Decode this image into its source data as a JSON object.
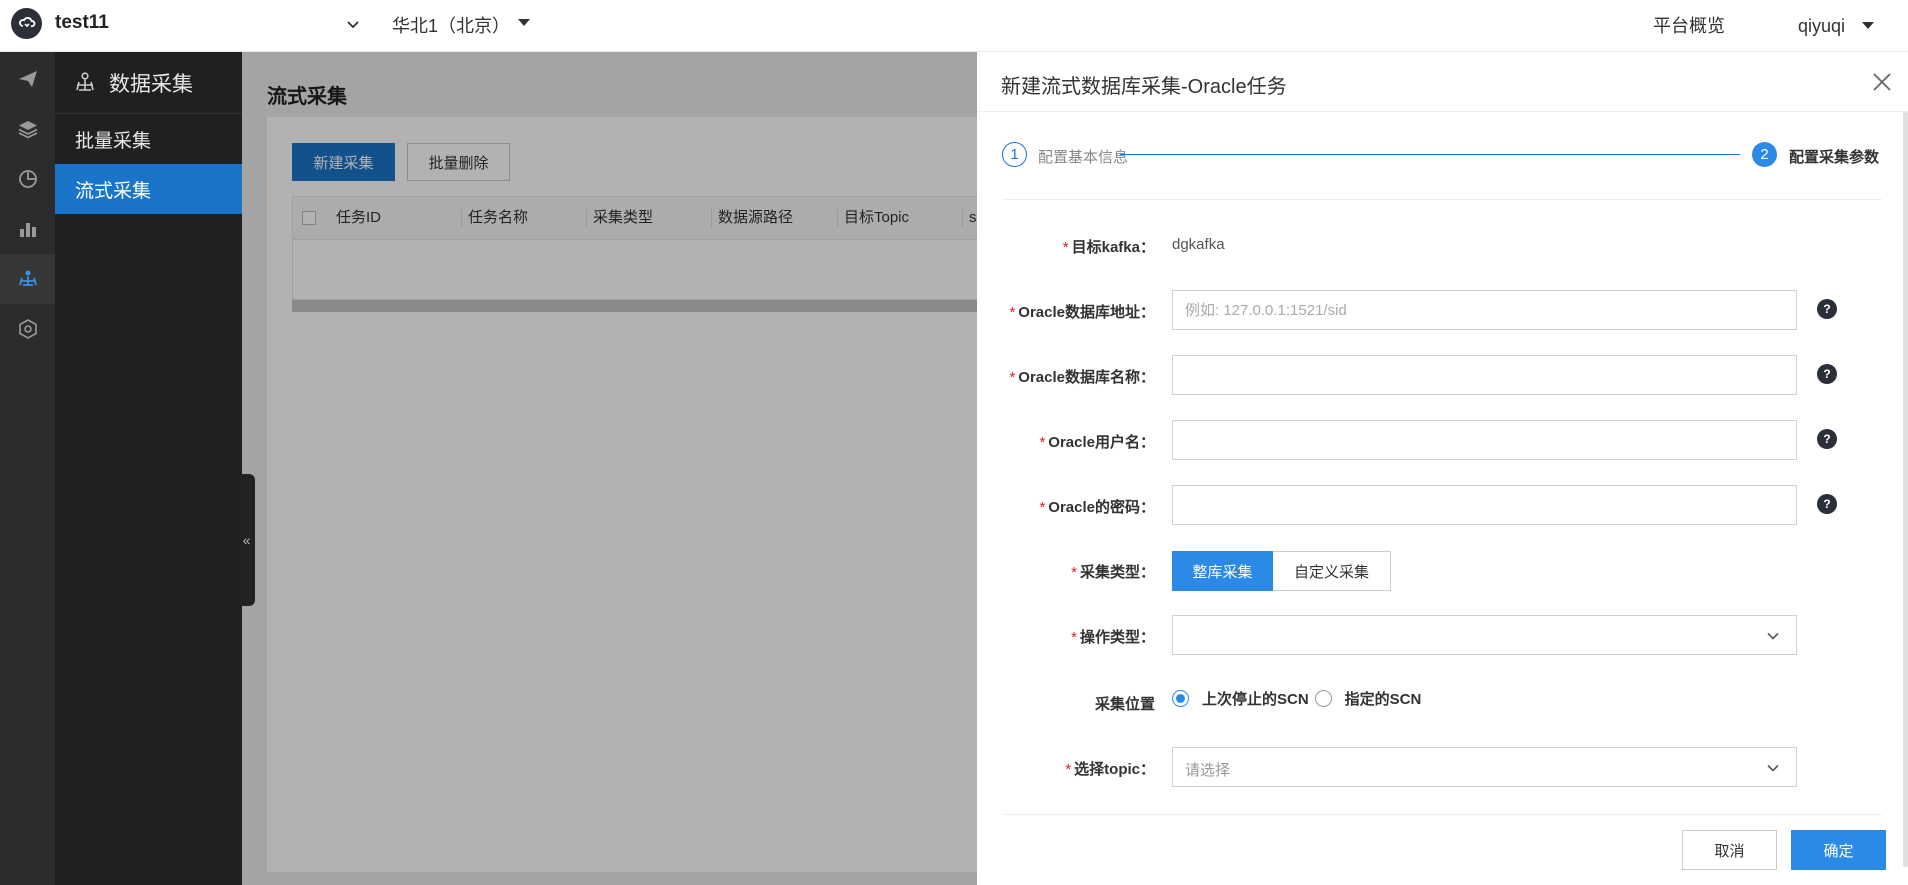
{
  "topbar": {
    "project": "test11",
    "region": "华北1（北京）",
    "overview": "平台概览",
    "user": "qiyuqi"
  },
  "rail": {
    "icons": [
      "paper-plane-icon",
      "layers-icon",
      "pie-chart-icon",
      "bar-chart-icon",
      "data-collect-icon",
      "service-gear-icon"
    ]
  },
  "sidebar": {
    "title": "数据采集",
    "items": [
      {
        "label": "批量采集"
      },
      {
        "label": "流式采集"
      }
    ]
  },
  "main": {
    "title": "流式采集",
    "new_button": "新建采集",
    "batch_delete_button": "批量删除",
    "columns": [
      "任务ID",
      "任务名称",
      "采集类型",
      "数据源路径",
      "目标Topic",
      "sc"
    ]
  },
  "drawer": {
    "title": "新建流式数据库采集-Oracle任务",
    "steps": [
      {
        "num": "1",
        "label": "配置基本信息"
      },
      {
        "num": "2",
        "label": "配置采集参数"
      }
    ],
    "fields": {
      "kafka": {
        "label": "目标kafka：",
        "value": "dgkafka"
      },
      "db_address": {
        "label": "Oracle数据库地址：",
        "placeholder": "例如: 127.0.0.1:1521/sid"
      },
      "db_name": {
        "label": "Oracle数据库名称："
      },
      "username": {
        "label": "Oracle用户名："
      },
      "password": {
        "label": "Oracle的密码："
      },
      "collect_type": {
        "label": "采集类型：",
        "options": [
          "整库采集",
          "自定义采集"
        ]
      },
      "op_type": {
        "label": "操作类型："
      },
      "position": {
        "label": "采集位置",
        "options": [
          "上次停止的SCN",
          "指定的SCN"
        ]
      },
      "topic": {
        "label": "选择topic：",
        "placeholder": "请选择"
      }
    },
    "help": "?",
    "cancel": "取消",
    "ok": "确定"
  },
  "collapse_glyph": "«"
}
